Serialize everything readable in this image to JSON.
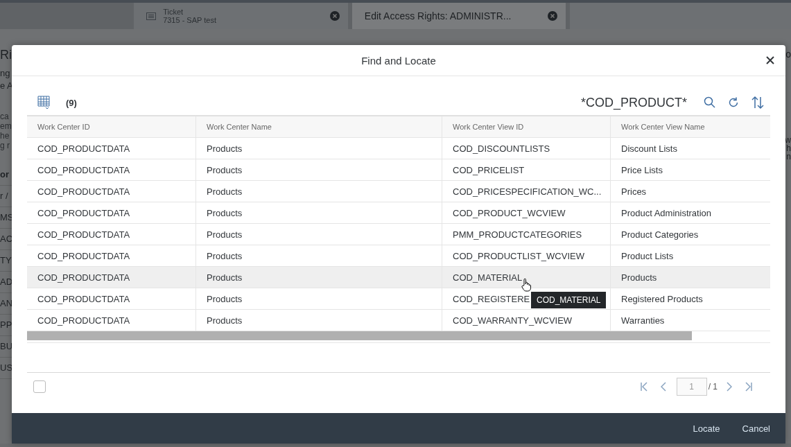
{
  "background": {
    "tabs": [
      {
        "kind": "ticket",
        "title": "Ticket",
        "subtitle": "7315 - SAP test",
        "selected": false
      },
      {
        "kind": "plain",
        "title": "Edit Access Rights: ADMINISTR...",
        "selected": true
      }
    ],
    "heading": "Ri",
    "labels": [
      "ng",
      "e A"
    ],
    "paragraph": [
      "ca",
      "em",
      "he",
      "g r"
    ],
    "rows": [
      "or",
      "r /",
      "MS",
      "AC",
      "TY",
      "AD",
      "AN",
      "PP",
      "BU",
      "US"
    ],
    "right_heading": "o",
    "right_paragraph": [
      "w",
      "h",
      "n"
    ]
  },
  "dialog": {
    "title": "Find and Locate",
    "count": "(9)",
    "search_term": "*COD_PRODUCT*",
    "columns": [
      "Work Center ID",
      "Work Center Name",
      "Work Center View ID",
      "Work Center View Name"
    ],
    "rows": [
      {
        "cells": [
          "COD_PRODUCTDATA",
          "Products",
          "COD_DISCOUNTLISTS",
          "Discount Lists"
        ],
        "selected": false
      },
      {
        "cells": [
          "COD_PRODUCTDATA",
          "Products",
          "COD_PRICELIST",
          "Price Lists"
        ],
        "selected": false
      },
      {
        "cells": [
          "COD_PRODUCTDATA",
          "Products",
          "COD_PRICESPECIFICATION_WC...",
          "Prices"
        ],
        "selected": false
      },
      {
        "cells": [
          "COD_PRODUCTDATA",
          "Products",
          "COD_PRODUCT_WCVIEW",
          "Product Administration"
        ],
        "selected": false
      },
      {
        "cells": [
          "COD_PRODUCTDATA",
          "Products",
          "PMM_PRODUCTCATEGORIES",
          "Product Categories"
        ],
        "selected": false
      },
      {
        "cells": [
          "COD_PRODUCTDATA",
          "Products",
          "COD_PRODUCTLIST_WCVIEW",
          "Product Lists"
        ],
        "selected": false
      },
      {
        "cells": [
          "COD_PRODUCTDATA",
          "Products",
          "COD_MATERIAL",
          "Products"
        ],
        "selected": true
      },
      {
        "cells": [
          "COD_PRODUCTDATA",
          "Products",
          "COD_REGISTERE",
          "Registered Products"
        ],
        "selected": false
      },
      {
        "cells": [
          "COD_PRODUCTDATA",
          "Products",
          "COD_WARRANTY_WCVIEW",
          "Warranties"
        ],
        "selected": false
      }
    ],
    "tooltip": "COD_MATERIAL",
    "select_all": {
      "checked": false
    },
    "pager": {
      "page": "1",
      "total": "/ 1"
    },
    "buttons": [
      "Locate",
      "Cancel"
    ]
  }
}
